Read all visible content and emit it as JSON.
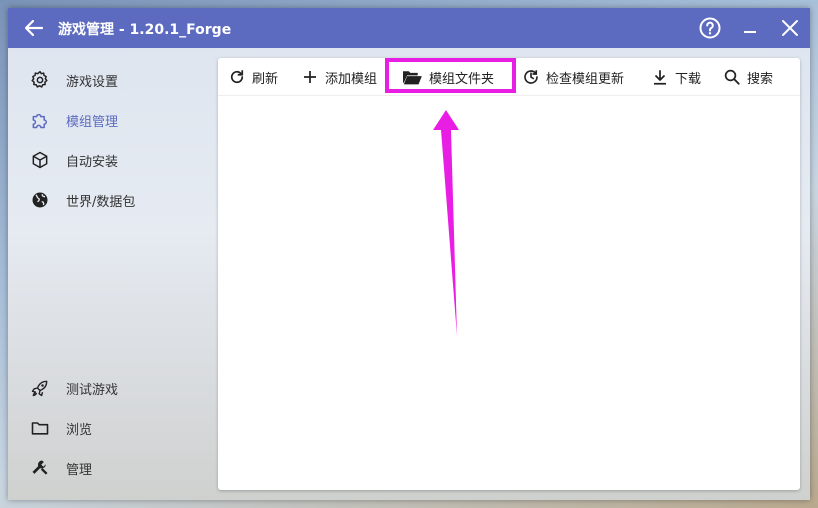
{
  "window": {
    "title": "游戏管理 - 1.20.1_Forge",
    "accent_color": "#5c6bc0",
    "icons": {
      "back": "arrow-left-icon",
      "help": "help-circle-icon",
      "minimize": "minimize-icon",
      "close": "close-icon"
    }
  },
  "sidebar": {
    "top_items": [
      {
        "label": "游戏设置",
        "icon": "gear-icon",
        "active": false
      },
      {
        "label": "模组管理",
        "icon": "puzzle-icon",
        "active": true
      },
      {
        "label": "自动安装",
        "icon": "cube-icon",
        "active": false
      },
      {
        "label": "世界/数据包",
        "icon": "globe-icon",
        "active": false
      }
    ],
    "bottom_items": [
      {
        "label": "测试游戏",
        "icon": "rocket-icon"
      },
      {
        "label": "浏览",
        "icon": "folder-icon"
      },
      {
        "label": "管理",
        "icon": "wrench-icon"
      }
    ]
  },
  "toolbar": {
    "buttons": [
      {
        "label": "刷新",
        "icon": "refresh-icon"
      },
      {
        "label": "添加模组",
        "icon": "plus-icon"
      },
      {
        "label": "模组文件夹",
        "icon": "folder-open-icon"
      },
      {
        "label": "检查模组更新",
        "icon": "update-clock-icon"
      },
      {
        "label": "下载",
        "icon": "download-icon"
      },
      {
        "label": "搜索",
        "icon": "search-icon"
      }
    ]
  },
  "annotation": {
    "highlight_color": "#e91ee4",
    "highlighted_button": "模组文件夹"
  }
}
